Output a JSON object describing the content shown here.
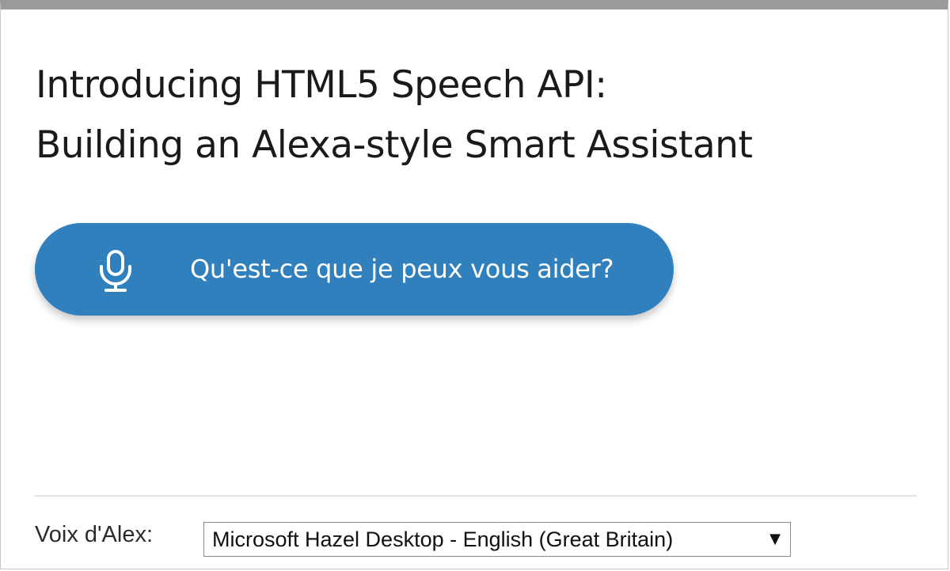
{
  "header": {
    "title_line1": "Introducing HTML5 Speech API:",
    "title_line2": "Building an Alexa-style Smart Assistant"
  },
  "assistant": {
    "button_label": "Qu'est-ce que je peux vous aider?",
    "icon": "microphone-icon"
  },
  "voice_selector": {
    "label": "Voix d'Alex:",
    "selected_value": "Microsoft Hazel Desktop - English (Great Britain)",
    "dropdown_icon": "chevron-down-icon"
  },
  "colors": {
    "button_bg": "#2f80bd",
    "top_bar": "#9a9a9a",
    "title_text": "#1a1a1a"
  }
}
